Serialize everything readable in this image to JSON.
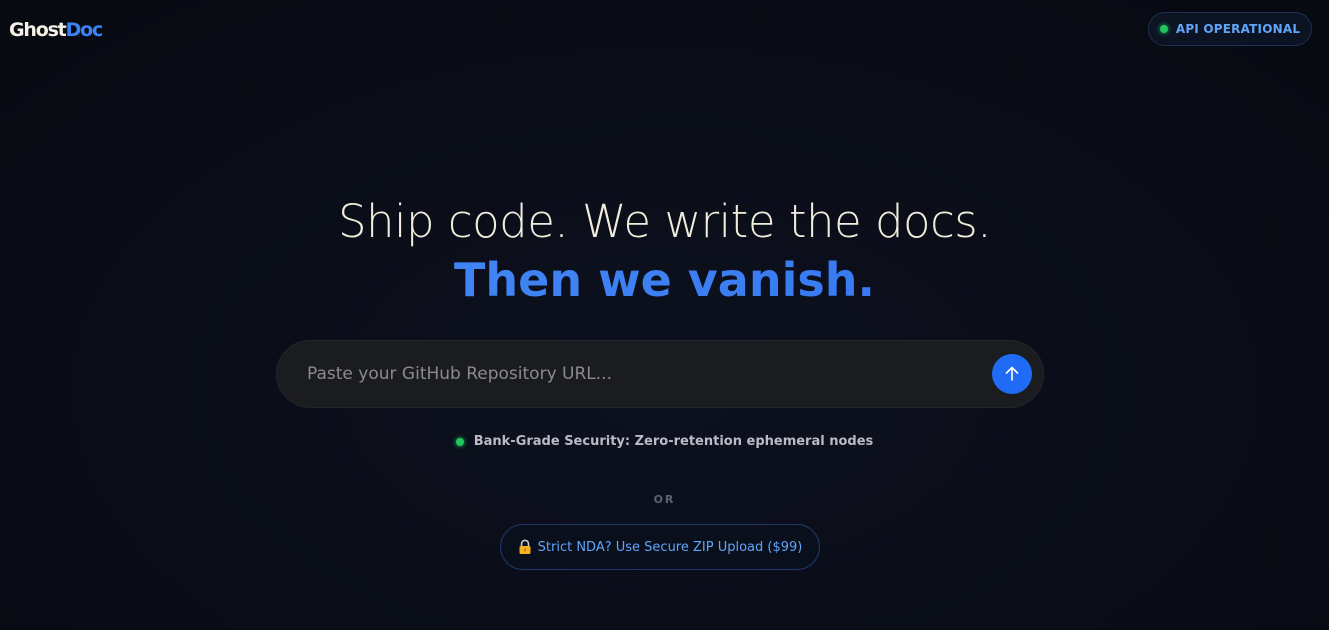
{
  "brand": {
    "logo_part1": "Ghost",
    "logo_part2": "Doc",
    "accent_color": "#3b82f6"
  },
  "status": {
    "label": "API OPERATIONAL",
    "indicator_color": "#22c55e"
  },
  "hero": {
    "headline": "Ship code. We write the docs.",
    "subheadline": "Then we vanish."
  },
  "search": {
    "placeholder": "Paste your GitHub Repository URL...",
    "value": "",
    "submit_icon": "arrow-up-icon"
  },
  "security": {
    "note": "Bank-Grade Security: Zero-retention ephemeral nodes"
  },
  "divider": {
    "label": "OR"
  },
  "zip_upload": {
    "label": "Strict NDA? Use Secure ZIP Upload ($99)",
    "icon": "lock-icon"
  }
}
